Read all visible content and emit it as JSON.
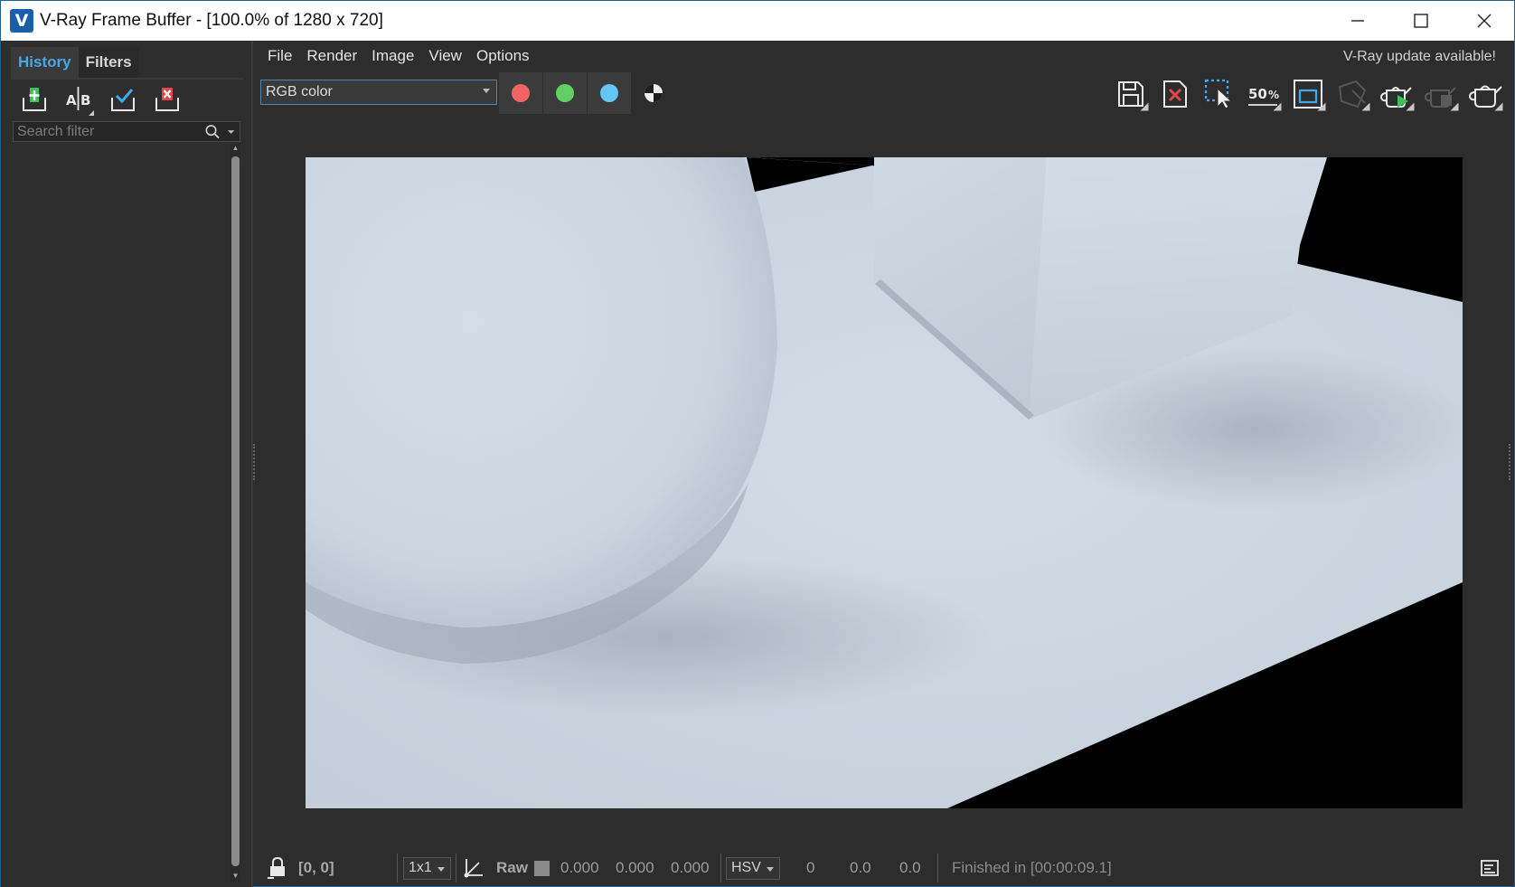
{
  "window": {
    "title": "V-Ray Frame Buffer - [100.0% of 1280 x 720]",
    "logo_letter": "V",
    "controls": {
      "minimize": "—",
      "maximize": "☐",
      "close": "✕"
    }
  },
  "left_panel": {
    "tabs": [
      {
        "label": "History"
      },
      {
        "label": "Filters"
      }
    ],
    "tools": [
      "add-to-history-icon",
      "ab-compare-icon",
      "load-checked-icon",
      "remove-icon"
    ],
    "search": {
      "placeholder": "Search filter",
      "value": ""
    }
  },
  "menu": {
    "items": [
      "File",
      "Render",
      "Image",
      "View",
      "Options"
    ]
  },
  "update_notice": "V-Ray update available!",
  "toolbar": {
    "channel": {
      "selected": "RGB color"
    },
    "color_buttons": [
      {
        "name": "red-channel",
        "color": "#f06464"
      },
      {
        "name": "green-channel",
        "color": "#62cf62"
      },
      {
        "name": "blue-channel",
        "color": "#64c6f2"
      }
    ],
    "zoom_label": "50",
    "right_icons": [
      "save-image-icon",
      "clear-image-icon",
      "track-mouse-icon",
      "zoom-50-icon",
      "region-render-icon",
      "stop-render-icon",
      "render-icon",
      "render-last-icon",
      "teapot-icon"
    ]
  },
  "render": {
    "resolution": "1280 x 720",
    "zoom_percent": 100.0
  },
  "status": {
    "coords": "[0, 0]",
    "sample": "1x1",
    "mode": "Raw",
    "rgb": [
      "0.000",
      "0.000",
      "0.000"
    ],
    "color_space": "HSV",
    "hsv": [
      "0",
      "0.0",
      "0.0"
    ],
    "message": "Finished in [00:00:09.1]"
  }
}
